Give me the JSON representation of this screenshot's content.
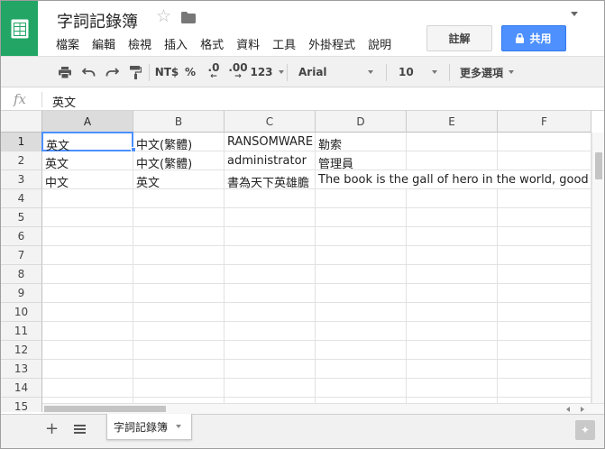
{
  "document": {
    "title": "字詞記錄簿",
    "menu": [
      "檔案",
      "編輯",
      "檢視",
      "插入",
      "格式",
      "資料",
      "工具",
      "外掛程式",
      "說明"
    ],
    "comments_label": "註解",
    "share_label": "共用"
  },
  "toolbar": {
    "currency": "NT$",
    "percent": "%",
    "decrease_decimal": ".0",
    "increase_decimal": ".00",
    "more_formats": "123",
    "font": "Arial",
    "font_size": "10",
    "more": "更多選項"
  },
  "formula_bar": {
    "fx": "fx",
    "value": "英文"
  },
  "grid": {
    "columns": [
      "A",
      "B",
      "C",
      "D",
      "E",
      "F"
    ],
    "rows": [
      "1",
      "2",
      "3",
      "4",
      "5",
      "6",
      "7",
      "8",
      "9",
      "10",
      "11",
      "12",
      "13",
      "14",
      "15"
    ],
    "data": [
      [
        "英文",
        "中文(繁體)",
        "RANSOMWARE",
        "勒索"
      ],
      [
        "英文",
        "中文(繁體)",
        "administrator",
        "管理員"
      ],
      [
        "中文",
        "英文",
        "書為天下英雄膽",
        "The book is the gall of hero in the world, good for hur"
      ]
    ],
    "active_cell": "A1",
    "selection_color": "#4d90fe"
  },
  "sheets": {
    "tabs": [
      "字詞記錄簿"
    ],
    "add_label": "+"
  },
  "colors": {
    "brand": "#22a565",
    "share": "#4d90fe"
  }
}
